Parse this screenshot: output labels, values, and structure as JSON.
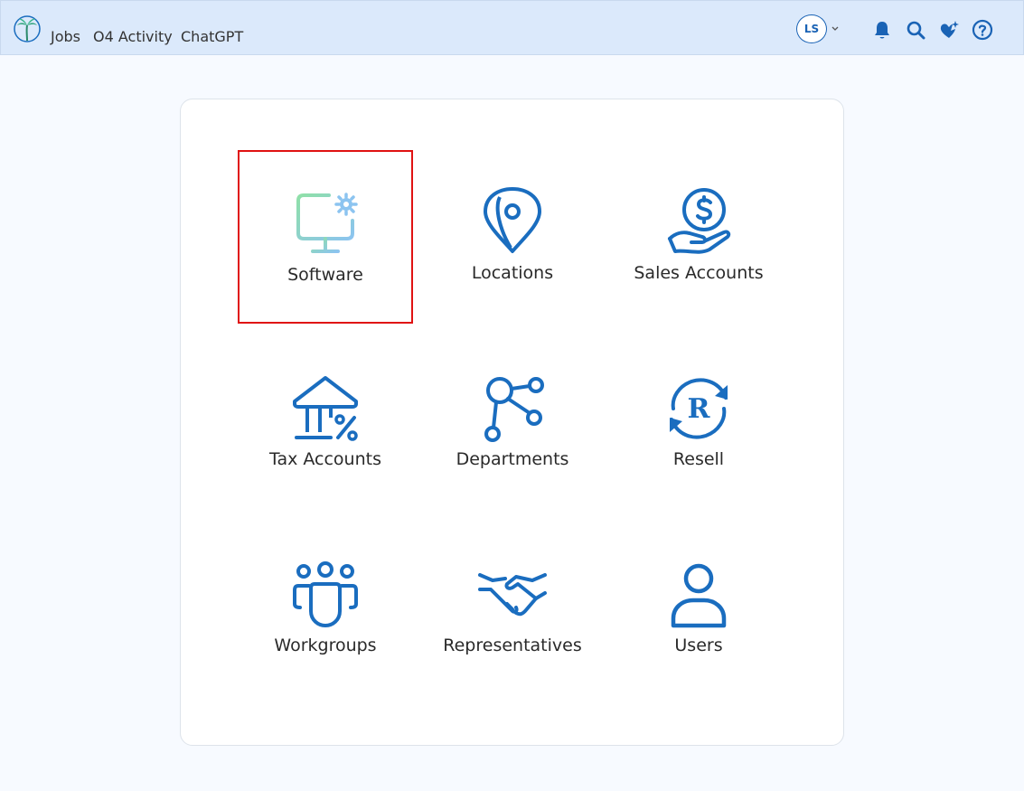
{
  "header": {
    "nav": [
      "Jobs",
      "O4 Activity",
      "ChatGPT"
    ],
    "avatar_initials": "LS",
    "icons": [
      "bell-icon",
      "search-icon",
      "sparkle-heart-icon",
      "help-icon"
    ]
  },
  "tiles": [
    {
      "label": "Software",
      "icon": "monitor-gear-icon",
      "selected": true
    },
    {
      "label": "Locations",
      "icon": "map-pin-icon"
    },
    {
      "label": "Sales Accounts",
      "icon": "hand-dollar-icon"
    },
    {
      "label": "Tax Accounts",
      "icon": "bank-percent-icon"
    },
    {
      "label": "Departments",
      "icon": "branch-nodes-icon"
    },
    {
      "label": "Resell",
      "icon": "refresh-r-icon"
    },
    {
      "label": "Workgroups",
      "icon": "group-icon"
    },
    {
      "label": "Representatives",
      "icon": "handshake-icon"
    },
    {
      "label": "Users",
      "icon": "user-icon"
    }
  ],
  "colors": {
    "accent": "#1a6dbf",
    "topbar": "#dbe9fb",
    "selection": "#e01212"
  }
}
